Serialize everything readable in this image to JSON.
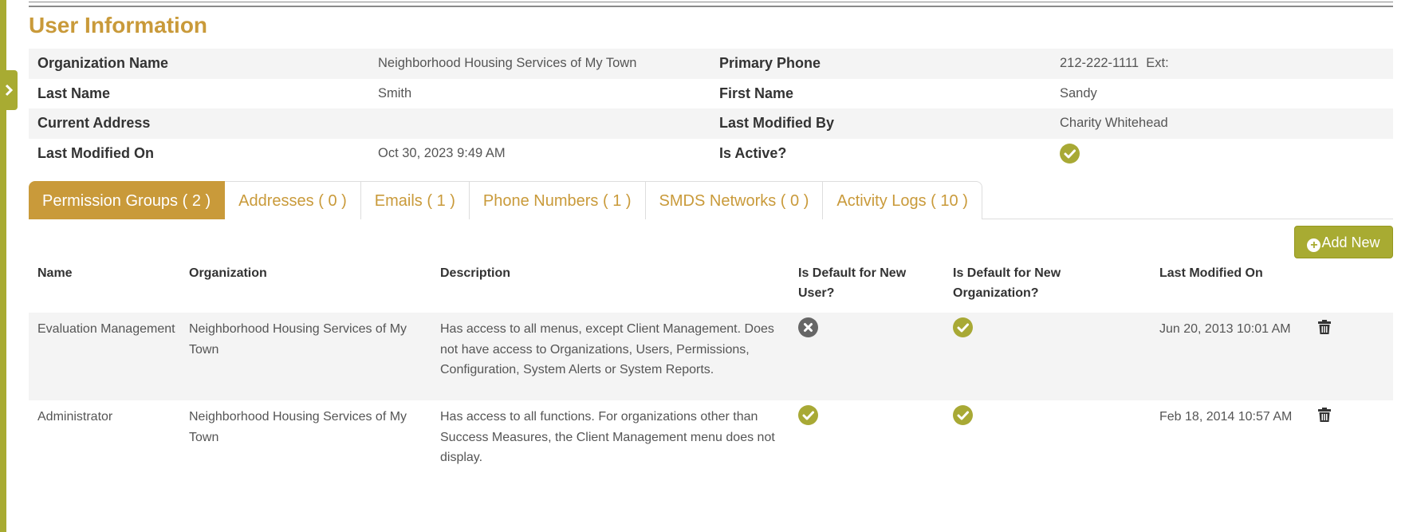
{
  "section_title": "User Information",
  "info": {
    "organization_name_label": "Organization Name",
    "organization_name_value": "Neighborhood Housing Services of My Town",
    "primary_phone_label": "Primary Phone",
    "primary_phone_value": "212-222-1111  Ext:",
    "last_name_label": "Last Name",
    "last_name_value": "Smith",
    "first_name_label": "First Name",
    "first_name_value": "Sandy",
    "current_address_label": "Current Address",
    "current_address_value": "",
    "last_modified_by_label": "Last Modified By",
    "last_modified_by_value": "Charity Whitehead",
    "last_modified_on_label": "Last Modified On",
    "last_modified_on_value": "Oct 30, 2023 9:49 AM",
    "is_active_label": "Is Active?",
    "is_active_icon": "check-circle-icon"
  },
  "tabs": [
    {
      "label": "Permission Groups ( 2 )",
      "active": true
    },
    {
      "label": "Addresses ( 0 )",
      "active": false
    },
    {
      "label": "Emails ( 1 )",
      "active": false
    },
    {
      "label": "Phone Numbers ( 1 )",
      "active": false
    },
    {
      "label": "SMDS Networks ( 0 )",
      "active": false
    },
    {
      "label": "Activity Logs ( 10 )",
      "active": false
    }
  ],
  "add_new_label": "Add New",
  "grid": {
    "columns": [
      "Name",
      "Organization",
      "Description",
      "Is Default for New User?",
      "Is Default for New Organization?",
      "Last Modified On"
    ],
    "rows": [
      {
        "name": "Evaluation Management",
        "organization": "Neighborhood Housing Services of My Town",
        "description": "Has access to all menus, except Client Management. Does not have access to Organizations, Users, Permissions, Configuration, System Alerts or System Reports.",
        "default_new_user_icon": "x-circle-icon",
        "default_new_org_icon": "check-circle-icon",
        "last_modified_on": "Jun 20, 2013 10:01 AM"
      },
      {
        "name": "Administrator",
        "organization": "Neighborhood Housing Services of My Town",
        "description": "Has access to all functions. For organizations other than Success Measures, the Client Management menu does not display.",
        "default_new_user_icon": "check-circle-icon",
        "default_new_org_icon": "check-circle-icon",
        "last_modified_on": "Feb 18, 2014 10:57 AM"
      }
    ]
  },
  "colors": {
    "accent_gold": "#c99a3a",
    "accent_olive": "#a8ab32",
    "shade": "#f4f4f4"
  }
}
